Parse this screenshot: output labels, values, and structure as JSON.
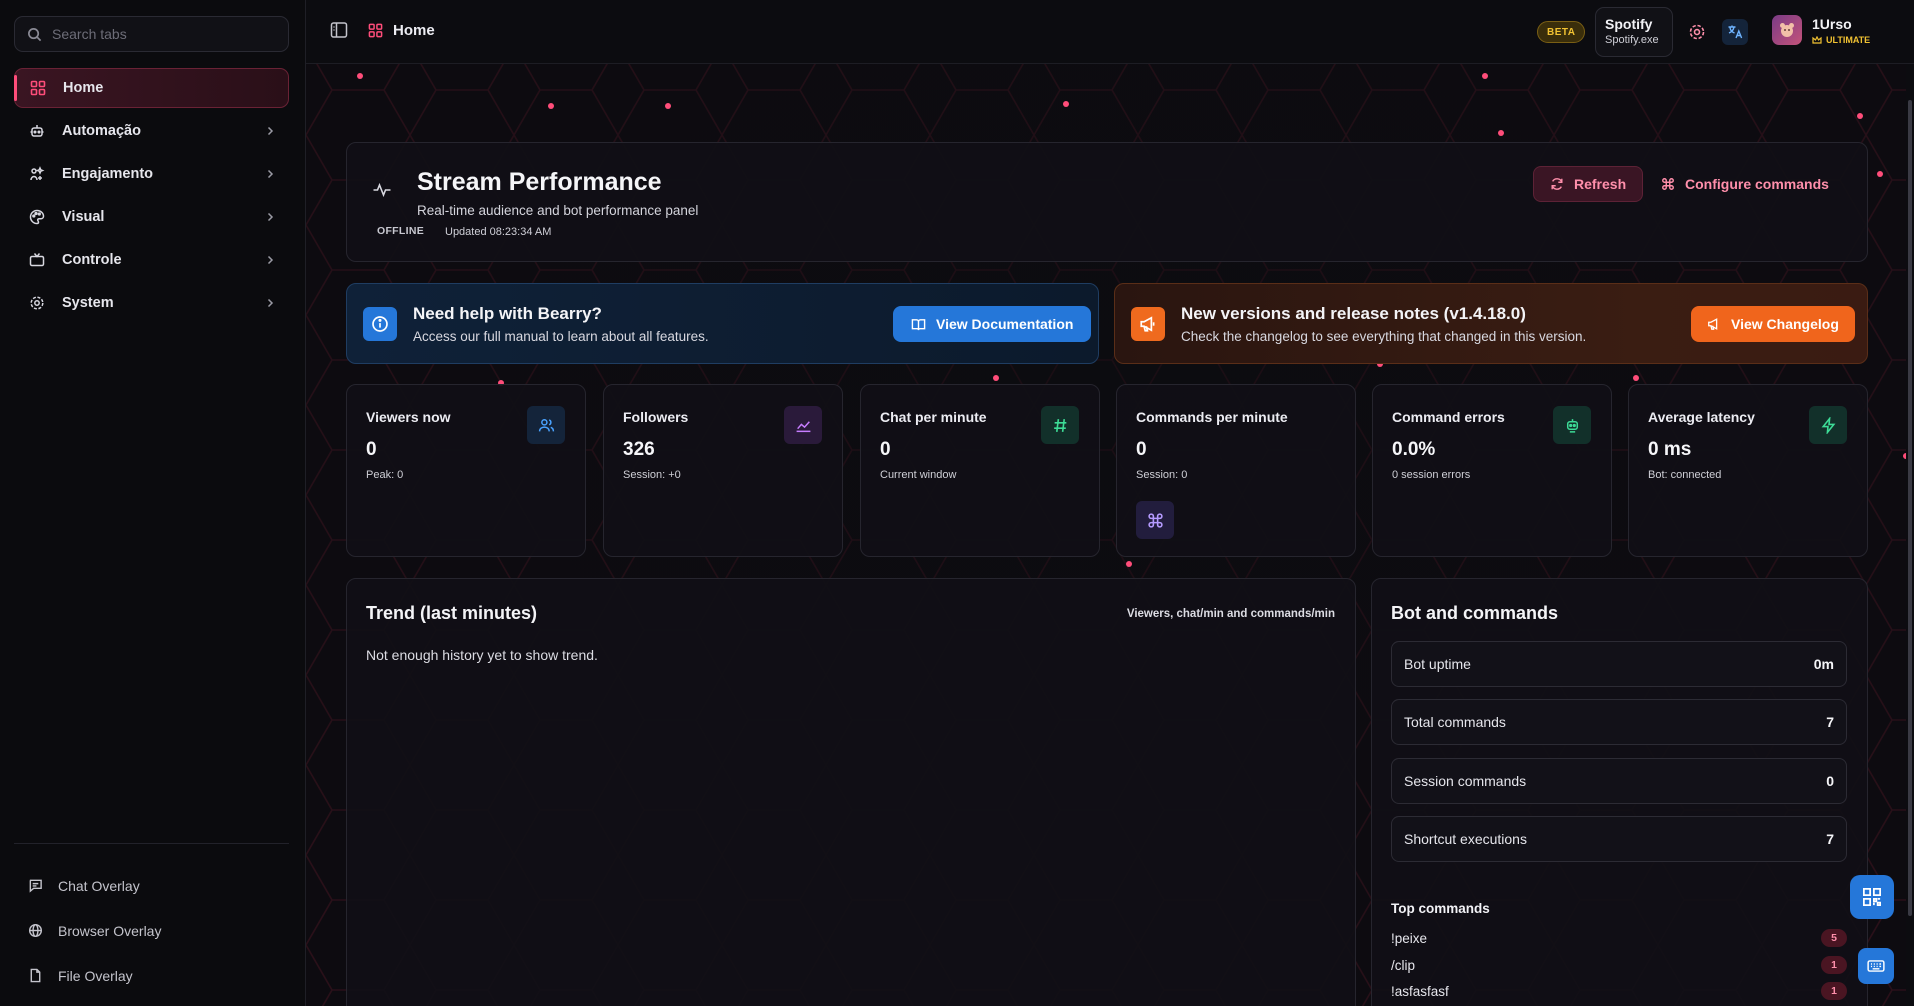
{
  "sidebar": {
    "search_placeholder": "Search tabs",
    "items": [
      {
        "label": "Home",
        "icon": "grid-icon",
        "active": true
      },
      {
        "label": "Automação",
        "icon": "robot-icon"
      },
      {
        "label": "Engajamento",
        "icon": "sparkle-icon"
      },
      {
        "label": "Visual",
        "icon": "palette-icon"
      },
      {
        "label": "Controle",
        "icon": "tv-icon"
      },
      {
        "label": "System",
        "icon": "gear-icon"
      }
    ],
    "bottom_items": [
      {
        "label": "Chat Overlay",
        "icon": "chat-icon"
      },
      {
        "label": "Browser Overlay",
        "icon": "globe-icon"
      },
      {
        "label": "File Overlay",
        "icon": "file-icon"
      }
    ]
  },
  "topbar": {
    "page_title": "Home",
    "beta_label": "BETA",
    "media_title": "Spotify",
    "media_subtitle": "Spotify.exe",
    "user_name": "1Urso",
    "user_tier": "ULTIMATE"
  },
  "performance": {
    "title": "Stream Performance",
    "subtitle": "Real-time audience and bot performance panel",
    "status": "OFFLINE",
    "updated": "Updated 08:23:34 AM",
    "refresh_label": "Refresh",
    "configure_label": "Configure commands"
  },
  "help_banner": {
    "title": "Need help with Bearry?",
    "subtitle": "Access our full manual to learn about all features.",
    "button": "View Documentation"
  },
  "notes_banner": {
    "title": "New versions and release notes (v1.4.18.0)",
    "subtitle": "Check the changelog to see everything that changed in this version.",
    "button": "View Changelog"
  },
  "stats": [
    {
      "label": "Viewers now",
      "value": "0",
      "sub": "Peak: 0",
      "icon": "users-icon",
      "color": "#4aa3ff",
      "bg": "#14243a"
    },
    {
      "label": "Followers",
      "value": "326",
      "sub": "Session: +0",
      "icon": "trend-icon",
      "color": "#c77dff",
      "bg": "#2a1a3a"
    },
    {
      "label": "Chat per minute",
      "value": "0",
      "sub": "Current window",
      "icon": "hash-icon",
      "color": "#3ddc97",
      "bg": "#12302a"
    },
    {
      "label": "Commands per minute",
      "value": "0",
      "sub": "Session: 0",
      "icon": "command-icon",
      "color": "#b59bff",
      "bg": "#221d3d"
    },
    {
      "label": "Command errors",
      "value": "0.0%",
      "sub": "0 session errors",
      "icon": "bot-icon",
      "color": "#3ddc97",
      "bg": "#12302a"
    },
    {
      "label": "Average latency",
      "value": "0 ms",
      "sub": "Bot: connected",
      "icon": "bolt-icon",
      "color": "#3ddc97",
      "bg": "#12302a"
    }
  ],
  "trend": {
    "title": "Trend (last minutes)",
    "legend": "Viewers, chat/min and commands/min",
    "message": "Not enough history yet to show trend."
  },
  "bot": {
    "title": "Bot and commands",
    "rows": [
      {
        "label": "Bot uptime",
        "value": "0m"
      },
      {
        "label": "Total commands",
        "value": "7"
      },
      {
        "label": "Session commands",
        "value": "0"
      },
      {
        "label": "Shortcut executions",
        "value": "7"
      }
    ],
    "top_title": "Top commands",
    "top_commands": [
      {
        "name": "!peixe",
        "count": "5"
      },
      {
        "name": "/clip",
        "count": "1"
      },
      {
        "name": "!asfasfasf",
        "count": "1"
      }
    ]
  },
  "colors": {
    "accent": "#ff4d7a",
    "info_blue": "#2577d9",
    "orange": "#f0651c",
    "gold": "#f1c232"
  }
}
